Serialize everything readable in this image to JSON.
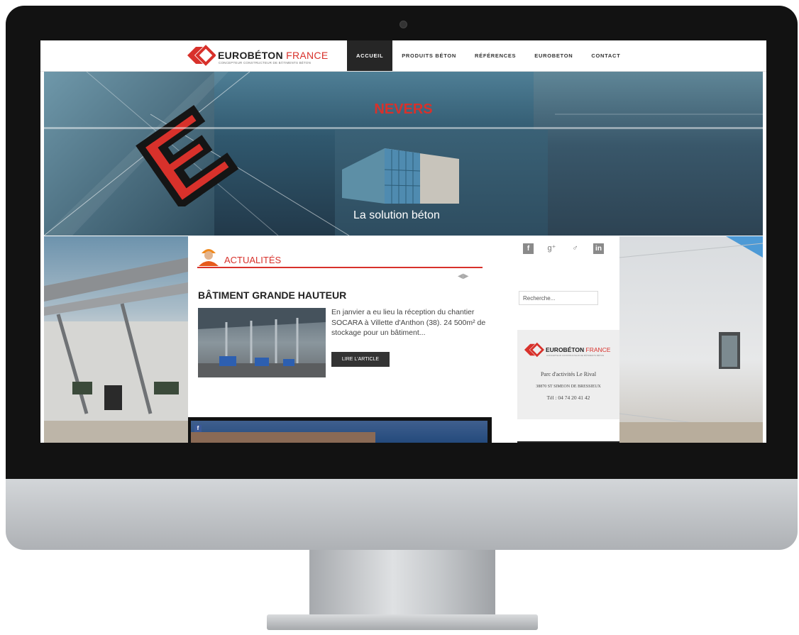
{
  "header": {
    "brand_primary": "EUROBÉTON",
    "brand_secondary": "FRANCE",
    "tagline": "CONCEPTEUR CONSTRUCTEUR DE BÂTIMENTS BÉTON",
    "nav": [
      {
        "label": "ACCUEIL",
        "active": true
      },
      {
        "label": "PRODUITS BÉTON"
      },
      {
        "label": "RÉFÉRENCES"
      },
      {
        "label": "EUROBETON"
      },
      {
        "label": "CONTACT"
      }
    ]
  },
  "hero": {
    "title": "NEVERS",
    "subtitle": "La solution béton"
  },
  "news": {
    "heading": "ACTUALITÉS",
    "article_title": "BÂTIMENT GRANDE HAUTEUR",
    "article_excerpt": "En janvier a eu lieu la réception du chantier SOCARA à Villette d'Anthon (38). 24 500m² de stockage pour un bâtiment...",
    "read_more": "LIRE L'ARTICLE"
  },
  "sidebar": {
    "search_placeholder": "Recherche...",
    "card_brand_primary": "EUROBÉTON",
    "card_brand_secondary": "FRANCE",
    "card_tagline": "CONCEPTEUR CONSTRUCTEUR DE BÂTIMENTS BÉTON",
    "address_line1": "Parc d'activités Le Rival",
    "address_line2": "38870 ST SIMEON DE BRESSIEUX",
    "phone": "Tél : 04 74 20 41 42",
    "social_icons": [
      "facebook-icon",
      "google-plus-icon",
      "viadeo-icon",
      "linkedin-icon"
    ]
  },
  "colors": {
    "accent": "#d8312b",
    "dark": "#262626"
  }
}
